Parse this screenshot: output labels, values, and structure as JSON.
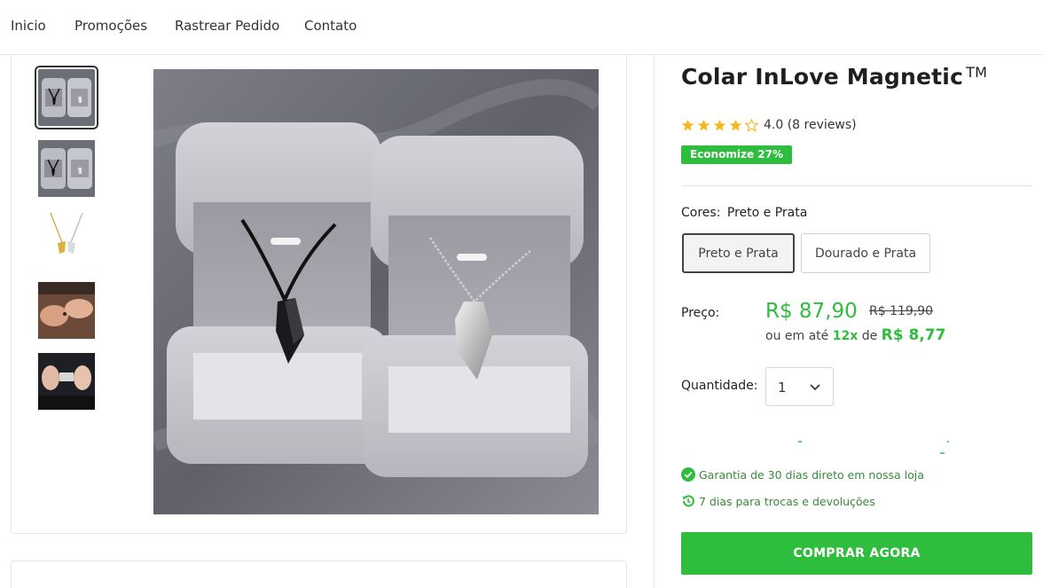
{
  "nav": {
    "items": [
      "Inicio",
      "Promoções",
      "Rastrear Pedido",
      "Contato"
    ]
  },
  "product": {
    "title": "Colar InLove Magnetic",
    "trademark": "TM",
    "rating_text": "4.0 (8 reviews)",
    "rating_value": 4.0,
    "rating_max": 5,
    "discount_badge": "Economize 27%",
    "colors_label": "Cores:",
    "selected_color": "Preto e Prata",
    "color_options": [
      "Preto e Prata",
      "Dourado e Prata"
    ],
    "price_label": "Preço:",
    "price": "R$ 87,90",
    "old_price": "R$ 119,90",
    "installment_prefix": "ou em até",
    "installment_count": "12x",
    "installment_mid": "de",
    "installment_value": "R$ 8,77",
    "quantity_label": "Quantidade:",
    "quantity_value": "1",
    "guarantee_30": "Garantia de 30 dias direto em nossa loja",
    "returns_7": "7 dias para trocas e devoluções",
    "buy_button": "COMPRAR AGORA"
  },
  "colors": {
    "accent_green": "#2fbd3d",
    "dark_text": "#1f1f1f",
    "guarantee_green": "#3a8a3a"
  },
  "thumbnails": [
    "thumb-boxes-1",
    "thumb-boxes-2",
    "thumb-gold-silver",
    "thumb-couple-hands",
    "thumb-fingers-touch"
  ]
}
